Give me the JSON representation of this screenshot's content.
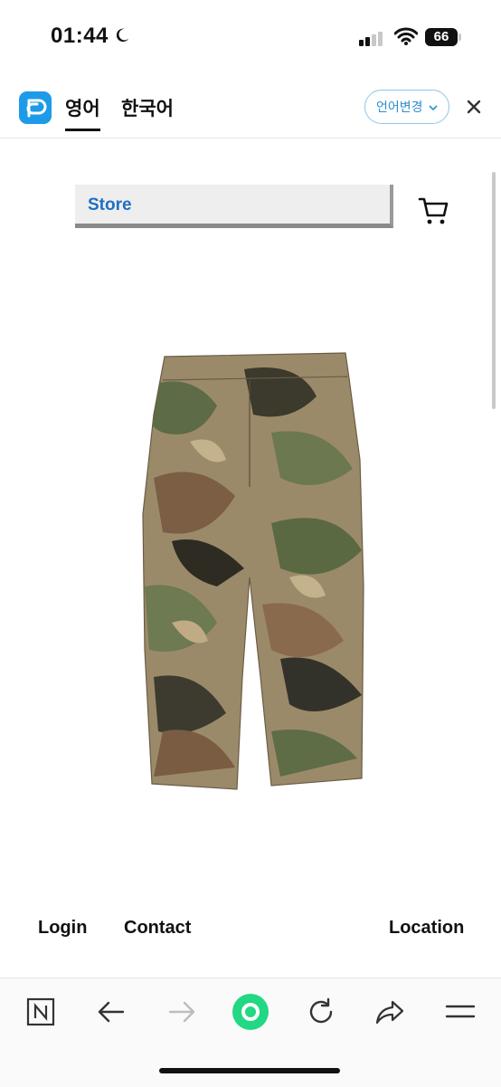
{
  "status_bar": {
    "time": "01:44",
    "battery": "66"
  },
  "translate_bar": {
    "tab_active": "영어",
    "tab_other": "한국어",
    "lang_change": "언어변경"
  },
  "store": {
    "label": "Store"
  },
  "footer": {
    "login": "Login",
    "contact": "Contact",
    "location": "Location"
  },
  "colors": {
    "accent": "#1e9be8",
    "store_text": "#1f6fc4",
    "record_button": "#22d883"
  },
  "icons": [
    "moon-icon",
    "signal-icon",
    "wifi-icon",
    "battery-icon",
    "app-logo-icon",
    "chevron-down-icon",
    "close-icon",
    "cart-icon",
    "naver-n-icon",
    "back-arrow-icon",
    "forward-arrow-icon",
    "record-icon",
    "reload-icon",
    "share-icon",
    "menu-icon"
  ]
}
